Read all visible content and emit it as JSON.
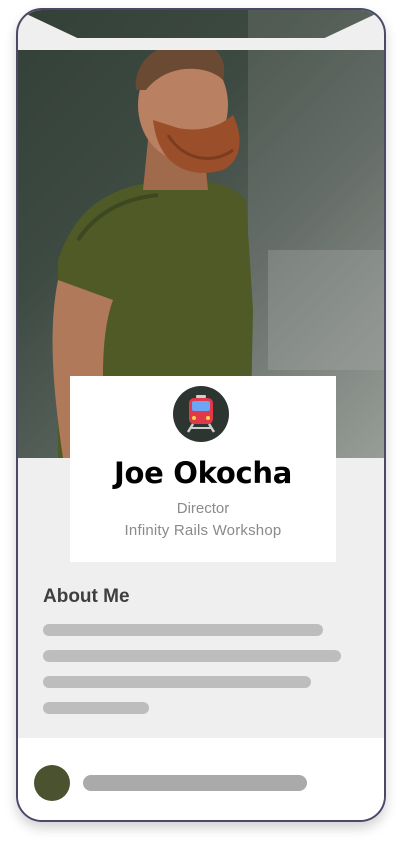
{
  "profile": {
    "name": "Joe Okocha",
    "role": "Director",
    "company": "Infinity Rails Workshop",
    "avatar_icon": "train-icon",
    "photo": "profile-photo"
  },
  "about": {
    "title": "About Me",
    "text_placeholder_lines": 4
  },
  "footer": {
    "avatar_color": "#4b5230",
    "bar_color": "#aaaaaa"
  },
  "colors": {
    "frame_border": "#4b4868",
    "section_bg": "#efefef",
    "card_bg": "#ffffff",
    "name_text": "#000000",
    "muted_text": "#8a8a8a",
    "placeholder_line": "#bdbdbd"
  }
}
